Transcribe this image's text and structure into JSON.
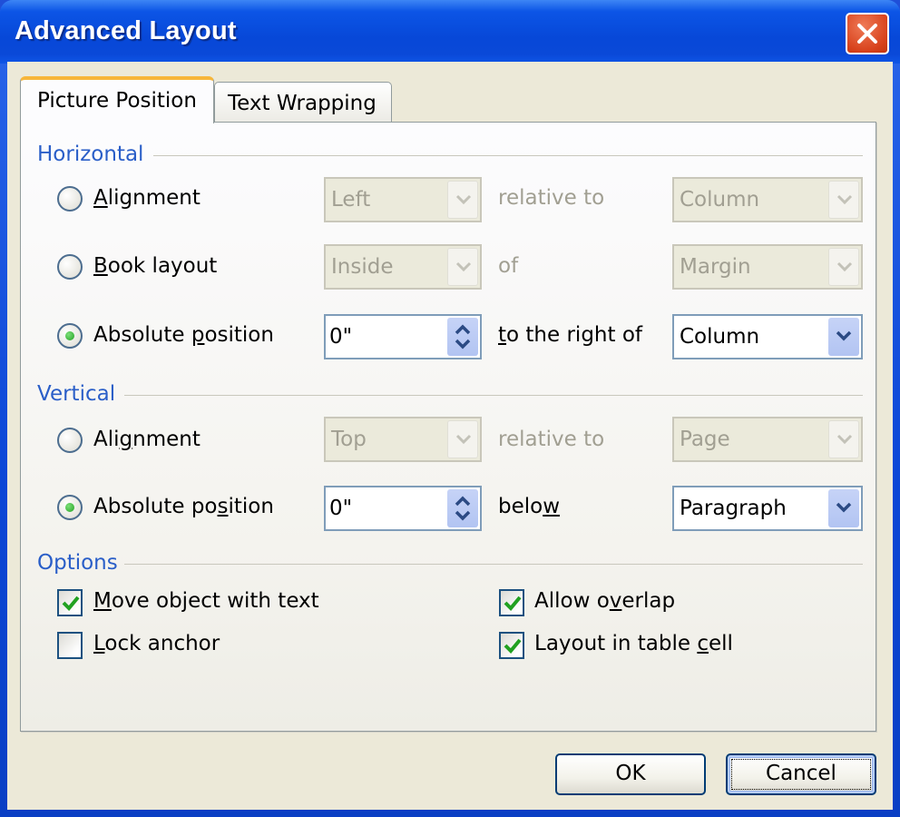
{
  "window": {
    "title": "Advanced Layout",
    "close_icon": "close-x-icon"
  },
  "tabs": [
    {
      "label": "Picture Position",
      "active": true
    },
    {
      "label": "Text Wrapping",
      "active": false
    }
  ],
  "horizontal": {
    "group_label": "Horizontal",
    "rows": [
      {
        "option": "Alignment",
        "mnemonic": "A",
        "rest": "lignment",
        "selected": false,
        "value": "Left",
        "connector": "relative to",
        "target": "Column",
        "enabled": false
      },
      {
        "option": "Book layout",
        "mnemonic": "B",
        "rest": "ook layout",
        "selected": false,
        "value": "Inside",
        "connector": "of",
        "target": "Margin",
        "enabled": false
      },
      {
        "option": "Absolute position",
        "pre": "Absolute ",
        "mnemonic": "p",
        "rest": "osition",
        "selected": true,
        "value": "0\"",
        "connector_mnemonic": "t",
        "connector_rest": "o the right of",
        "connector": "to the right of",
        "target": "Column",
        "enabled": true
      }
    ]
  },
  "vertical": {
    "group_label": "Vertical",
    "rows": [
      {
        "option": "Alignment",
        "pre": "Ali",
        "mnemonic": "g",
        "rest": "nment",
        "selected": false,
        "value": "Top",
        "connector": "relative to",
        "target": "Page",
        "enabled": false
      },
      {
        "option": "Absolute position",
        "pre": "Absolute po",
        "mnemonic": "s",
        "rest": "ition",
        "selected": true,
        "value": "0\"",
        "connector_pre": "belo",
        "connector_mnemonic": "w",
        "connector": "below",
        "target": "Paragraph",
        "enabled": true
      }
    ]
  },
  "options": {
    "group_label": "Options",
    "items": [
      {
        "label": "Move object with text",
        "mnemonic": "M",
        "rest": "ove object with text",
        "checked": true
      },
      {
        "label": "Lock anchor",
        "mnemonic": "L",
        "rest": "ock anchor",
        "checked": false
      },
      {
        "label": "Allow overlap",
        "pre": "Allow o",
        "mnemonic": "v",
        "rest": "erlap",
        "checked": true
      },
      {
        "label": "Layout in table cell",
        "pre": "Layout in table ",
        "mnemonic": "c",
        "rest": "ell",
        "checked": true
      }
    ]
  },
  "buttons": {
    "ok": "OK",
    "cancel": "Cancel"
  },
  "colors": {
    "title_bar": "#0748d8",
    "group_label": "#2a5ec8",
    "active_tab_accent": "#f7b63a",
    "check_mark": "#21a121",
    "close_button": "#d8421c"
  }
}
